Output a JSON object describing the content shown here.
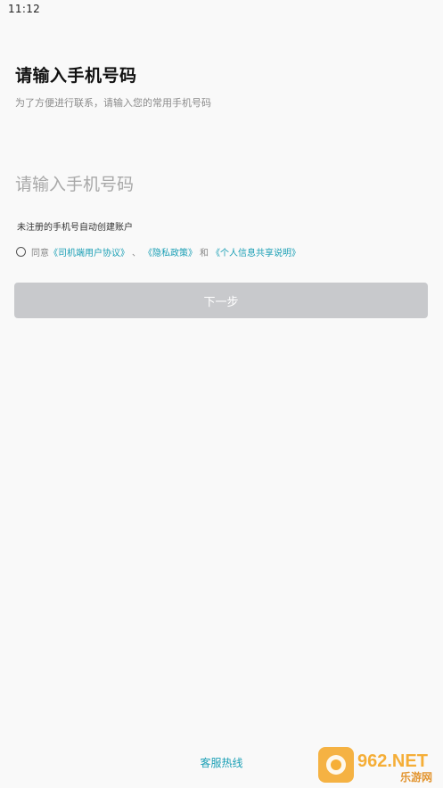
{
  "status_bar": {
    "time": "11:12"
  },
  "header": {
    "title": "请输入手机号码",
    "subtitle": "为了方便进行联系，请输入您的常用手机号码"
  },
  "phone": {
    "placeholder": "请输入手机号码",
    "value": ""
  },
  "hint": "未注册的手机号自动创建账户",
  "agreement": {
    "checked": false,
    "prefix": "同意",
    "link_driver_agreement": "《司机端用户协议》",
    "separator": "、",
    "link_privacy": "《隐私政策》",
    "conjunction": "和",
    "link_info_sharing": "《个人信息共享说明》"
  },
  "next_button": {
    "label": "下一步",
    "enabled": false
  },
  "footer": {
    "hotline": "客服热线"
  },
  "watermark": {
    "brand": "962.NET",
    "sub": "乐游网"
  },
  "colors": {
    "accent": "#1a9fb5",
    "button_disabled": "#c8c9cc",
    "background": "#f9f9f9"
  }
}
